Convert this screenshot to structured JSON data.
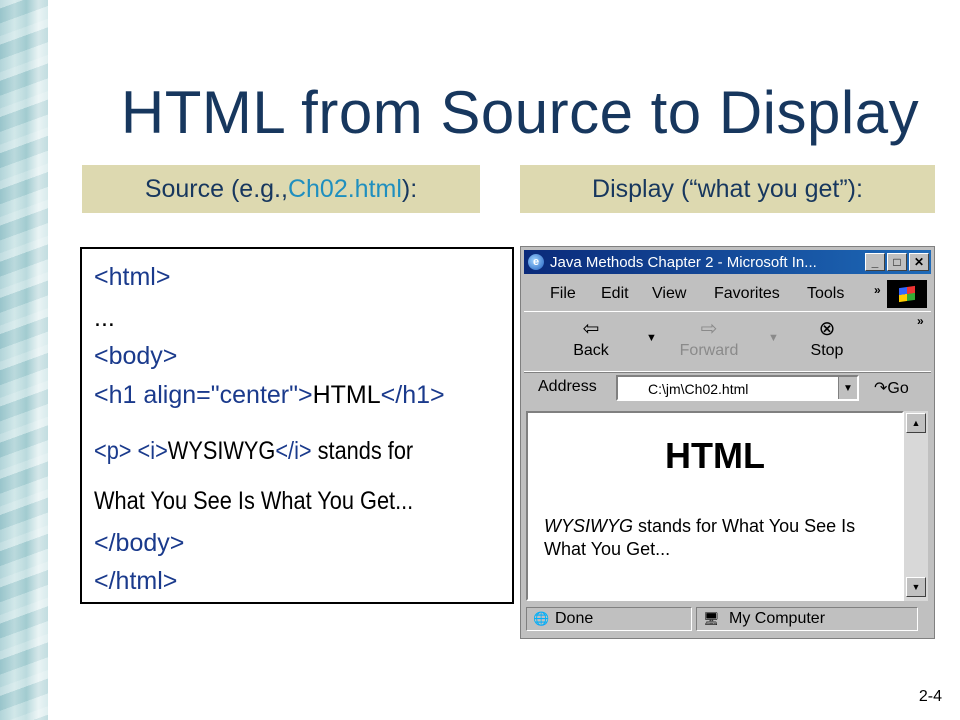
{
  "slide": {
    "title": "HTML from Source to Display",
    "source_header_prefix": "Source (e.g., ",
    "source_header_file": "Ch02.html",
    "source_header_suffix": "):",
    "display_header": "Display (“what you get”):",
    "slide_number": "2-4"
  },
  "source_code": {
    "line1": "<html>",
    "line2": "...",
    "line3": "<body>",
    "line4_tag_open": "<h1 align=\"center\">",
    "line4_text": "HTML",
    "line4_tag_close": "</h1>",
    "line5_tag_p": "<p>",
    "line5_tag_i_open": "<i>",
    "line5_text": "WYSIWYG",
    "line5_tag_i_close": "</i>",
    "line5_rest": " stands for",
    "line6": "What You See Is What You Get...",
    "line7": "</body>",
    "line8": "</html>"
  },
  "browser": {
    "window_title": "Java Methods Chapter 2 - Microsoft In...",
    "menu": [
      "File",
      "Edit",
      "View",
      "Favorites",
      "Tools"
    ],
    "toolbar": {
      "back": "Back",
      "forward": "Forward",
      "stop": "Stop"
    },
    "address_label": "Address",
    "address_value": "C:\\jm\\Ch02.html",
    "go_label": "Go",
    "content_heading": "HTML",
    "content_italic": "WYSIWYG",
    "content_text": " stands for What You See Is What You Get...",
    "status_left": "Done",
    "status_right": "My Computer",
    "colors": {
      "titlebar": "#0a2a7a",
      "chrome": "#c0c0c0"
    }
  }
}
